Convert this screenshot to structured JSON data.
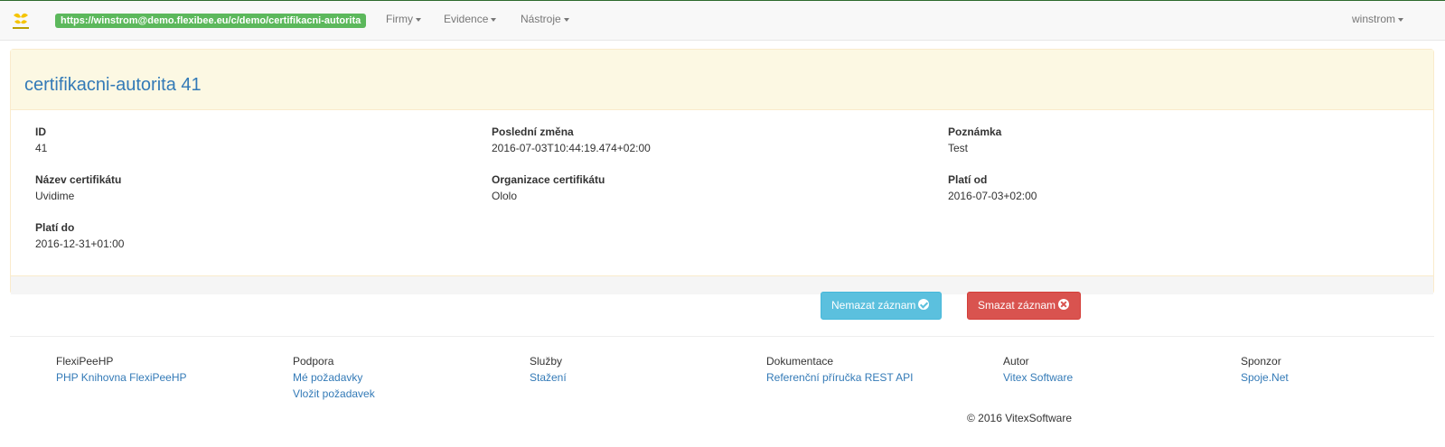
{
  "navbar": {
    "logo_icon": "flexipeehp-logo-icon",
    "url": "https://winstrom@demo.flexibee.eu/c/demo/certifikacni-autorita",
    "menus": [
      "Firmy",
      "Evidence",
      "Nástroje"
    ],
    "user": "winstrom"
  },
  "record": {
    "title": "certifikacni-autorita 41",
    "fields": {
      "id": {
        "label": "ID",
        "value": "41"
      },
      "last_change": {
        "label": "Poslední změna",
        "value": "2016-07-03T10:44:19.474+02:00"
      },
      "note": {
        "label": "Poznámka",
        "value": "Test"
      },
      "cert_name": {
        "label": "Název certifikátu",
        "value": "Uvidime"
      },
      "cert_org": {
        "label": "Organizace certifikátu",
        "value": "Ololo"
      },
      "valid_from": {
        "label": "Platí od",
        "value": "2016-07-03+02:00"
      },
      "valid_to": {
        "label": "Platí do",
        "value": "2016-12-31+01:00"
      }
    }
  },
  "actions": {
    "keep_label": "Nemazat záznam",
    "keep_icon": "check-circle-icon",
    "delete_label": "Smazat záznam",
    "delete_icon": "times-circle-icon"
  },
  "footer": {
    "columns": [
      {
        "heading": "FlexiPeeHP",
        "links": [
          "PHP Knihovna FlexiPeeHP"
        ]
      },
      {
        "heading": "Podpora",
        "links": [
          "Mé požadavky",
          "Vložit požadavek"
        ]
      },
      {
        "heading": "Služby",
        "links": [
          "Stažení"
        ]
      },
      {
        "heading": "Dokumentace",
        "links": [
          "Referenční příručka REST API"
        ]
      },
      {
        "heading": "Autor",
        "links": [
          "Vitex Software"
        ]
      },
      {
        "heading": "Sponzor",
        "links": [
          "Spoje.Net"
        ]
      }
    ],
    "copyright": "© 2016 VitexSoftware"
  },
  "colors": {
    "url_badge": "#5cb85c",
    "title": "#337ab7",
    "panel_heading": "#fcf8e3",
    "btn_info": "#5bc0de",
    "btn_danger": "#d9534f"
  }
}
